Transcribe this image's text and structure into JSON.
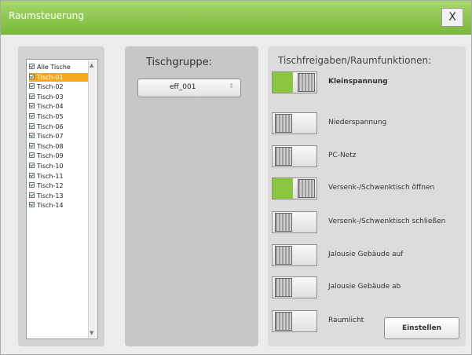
{
  "window": {
    "title": "Raumsteuerung",
    "close_label": "X",
    "accent": "#8cc63f"
  },
  "table_list": {
    "items": [
      {
        "label": "Alle Tische",
        "checked": true,
        "selected": false
      },
      {
        "label": "Tisch-01",
        "checked": true,
        "selected": true
      },
      {
        "label": "Tisch-02",
        "checked": true,
        "selected": false
      },
      {
        "label": "Tisch-03",
        "checked": true,
        "selected": false
      },
      {
        "label": "Tisch-04",
        "checked": true,
        "selected": false
      },
      {
        "label": "Tisch-05",
        "checked": true,
        "selected": false
      },
      {
        "label": "Tisch-06",
        "checked": true,
        "selected": false
      },
      {
        "label": "Tisch-07",
        "checked": true,
        "selected": false
      },
      {
        "label": "Tisch-08",
        "checked": true,
        "selected": false
      },
      {
        "label": "Tisch-09",
        "checked": true,
        "selected": false
      },
      {
        "label": "Tisch-10",
        "checked": true,
        "selected": false
      },
      {
        "label": "Tisch-11",
        "checked": true,
        "selected": false
      },
      {
        "label": "Tisch-12",
        "checked": true,
        "selected": false
      },
      {
        "label": "Tisch-13",
        "checked": true,
        "selected": false
      },
      {
        "label": "Tisch-14",
        "checked": true,
        "selected": false
      }
    ]
  },
  "group": {
    "label": "Tischgruppe:",
    "selected_value": "eff_001"
  },
  "functions": {
    "label": "Tischfreigaben/Raumfunktionen:",
    "rows": [
      {
        "label": "Kleinspannung",
        "on": true,
        "bold": true
      },
      {
        "label": "Niederspannung",
        "on": false,
        "bold": false
      },
      {
        "label": "PC-Netz",
        "on": false,
        "bold": false
      },
      {
        "label": "Versenk-/Schwenktisch öffnen",
        "on": true,
        "bold": false
      },
      {
        "label": "Versenk-/Schwenktisch schließen",
        "on": false,
        "bold": false
      },
      {
        "label": "Jalousie Gebäude auf",
        "on": false,
        "bold": false
      },
      {
        "label": "Jalousie Gebäude ab",
        "on": false,
        "bold": false
      },
      {
        "label": "Raumlicht",
        "on": false,
        "bold": false
      }
    ],
    "apply_button_label": "Einstellen"
  }
}
